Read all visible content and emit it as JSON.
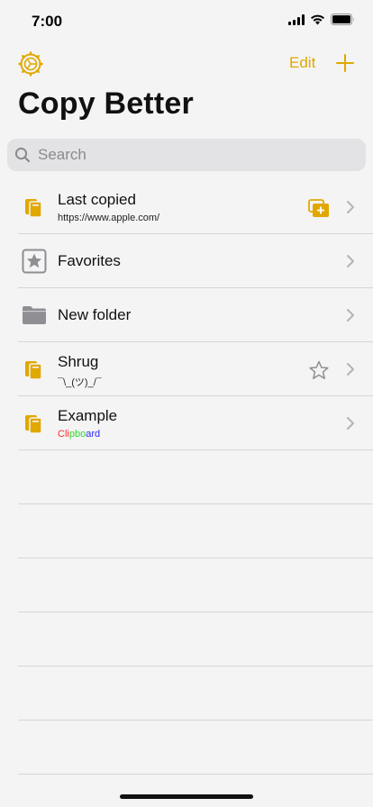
{
  "status_bar": {
    "time": "7:00"
  },
  "nav": {
    "edit_label": "Edit"
  },
  "page": {
    "title": "Copy Better"
  },
  "search": {
    "placeholder": "Search",
    "value": ""
  },
  "list": {
    "items": [
      {
        "title": "Last copied",
        "subtitle": "https://www.apple.com/",
        "icon": "clipboard-icon",
        "action_icon": "add-copy-icon"
      },
      {
        "title": "Favorites",
        "icon": "star-square-icon"
      },
      {
        "title": "New folder",
        "icon": "folder-icon"
      },
      {
        "title": "Shrug",
        "subtitle": "¯\\_(ツ)_/¯",
        "icon": "clipboard-icon",
        "action_icon": "star-icon"
      },
      {
        "title": "Example",
        "subtitle_parts": [
          {
            "text": "Cli",
            "color": "#ff2a2a"
          },
          {
            "text": "pbo",
            "color": "#2ed82e"
          },
          {
            "text": "ard",
            "color": "#2a2aff"
          }
        ],
        "icon": "clipboard-icon"
      }
    ]
  },
  "colors": {
    "accent": "#e0a800",
    "background": "#f4f4f4",
    "separator": "#d6d6d8",
    "icon_gray": "#8e8e93"
  }
}
